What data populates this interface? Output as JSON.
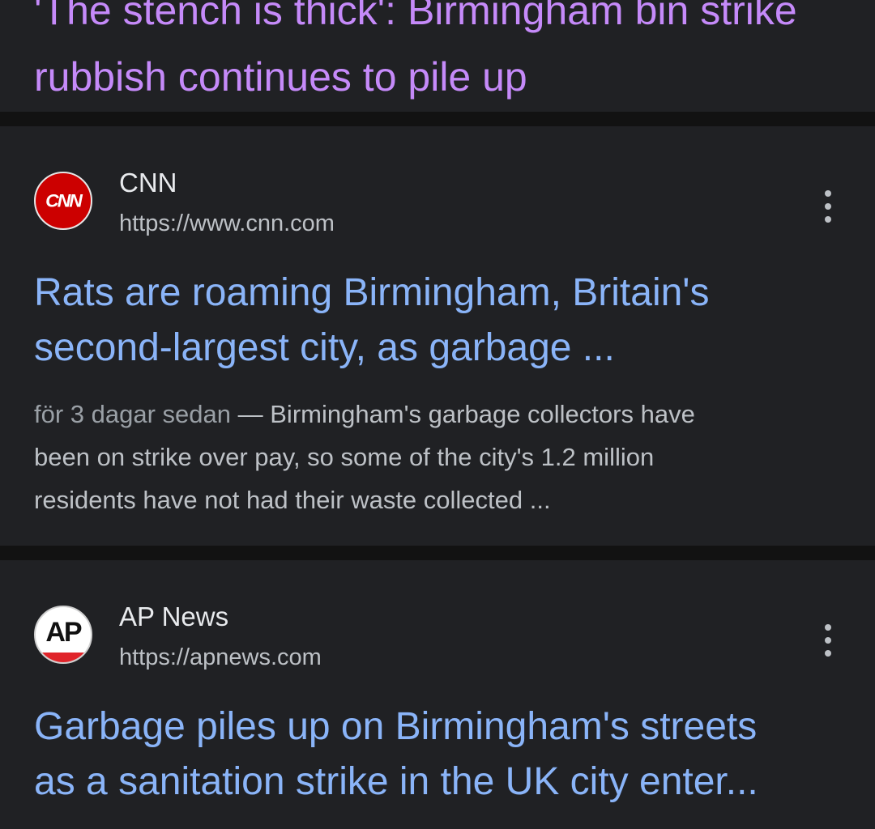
{
  "previous_result": {
    "title_line1": "'The stench is thick': Birmingham bin strike",
    "title_line2": "rubbish continues to pile up"
  },
  "results": [
    {
      "logo_text": "CNN",
      "source_name": "CNN",
      "url": "https://www.cnn.com",
      "title_line1": "Rats are roaming Birmingham, Britain's",
      "title_line2": "second-largest city, as garbage ...",
      "date": "för 3 dagar sedan",
      "separator": " — ",
      "snippet_line1": "Birmingham's garbage collectors have",
      "snippet_line2": "been on strike over pay, so some of the city's 1.2 million",
      "snippet_line3": "residents have not had their waste collected ..."
    },
    {
      "logo_text": "AP",
      "source_name": "AP News",
      "url": "https://apnews.com",
      "title_line1": "Garbage piles up on Birmingham's streets",
      "title_line2": "as a sanitation strike in the UK city enter..."
    }
  ],
  "colors": {
    "visited_link": "#c58af9",
    "link": "#8ab4f8",
    "background": "#202124",
    "separator": "#121212"
  },
  "icons": {
    "more_options": "vertical-ellipsis-icon"
  }
}
